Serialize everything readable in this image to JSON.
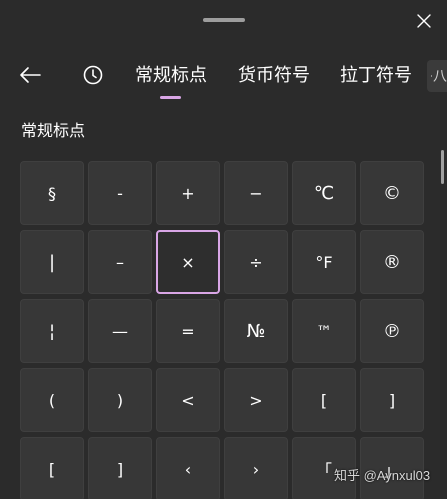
{
  "header": {
    "close_icon": "close-icon"
  },
  "tabs": {
    "back_icon": "arrow-left-icon",
    "history_icon": "clock-icon",
    "items": [
      {
        "label": "常规标点",
        "active": true
      },
      {
        "label": "货币符号",
        "active": false
      },
      {
        "label": "拉丁符号",
        "active": false
      }
    ],
    "overflow_icon": "chevron-right-icon",
    "overflow_partial": "八",
    "indicator_color": "#d9a6e6"
  },
  "section": {
    "title": "常规标点"
  },
  "symbols": [
    [
      "§",
      "-",
      "+",
      "−",
      "℃",
      "©"
    ],
    [
      "|",
      "–",
      "×",
      "÷",
      "°F",
      "®"
    ],
    [
      "¦",
      "—",
      "=",
      "№",
      "™",
      "℗"
    ],
    [
      "(",
      ")",
      "<",
      ">",
      "[",
      "]"
    ],
    [
      "[",
      "]",
      "‹",
      "›",
      "「",
      "」"
    ]
  ],
  "selected_symbol": "×",
  "watermark": "知乎 @Aynxul03",
  "colors": {
    "background": "#2b2b2b",
    "tile": "#373737",
    "accent": "#d9a6e6"
  }
}
